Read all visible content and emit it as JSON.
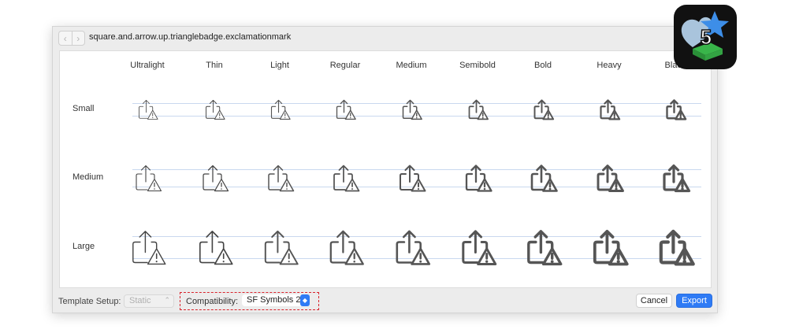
{
  "window": {
    "title": "square.and.arrow.up.trianglebadge.exclamationmark",
    "back_glyph": "‹",
    "forward_glyph": "›"
  },
  "grid": {
    "weights": [
      "Ultralight",
      "Thin",
      "Light",
      "Regular",
      "Medium",
      "Semibold",
      "Bold",
      "Heavy",
      "Black"
    ],
    "scales": [
      "Small",
      "Medium",
      "Large"
    ],
    "symbol_icon": "square-and-arrow-up-trianglebadge-exclamationmark-icon",
    "guide_color": "#c9d8ef"
  },
  "footer": {
    "template_setup_label": "Template Setup:",
    "template_setup_value": "Static",
    "compatibility_label": "Compatibility:",
    "compatibility_value": "SF Symbols 2",
    "cancel_label": "Cancel",
    "export_label": "Export",
    "highlight_color": "#d9232b",
    "accent_color": "#2f7bf5"
  },
  "app_icon": {
    "badge_text": "5",
    "icon_name": "sf-symbols-app-icon"
  }
}
